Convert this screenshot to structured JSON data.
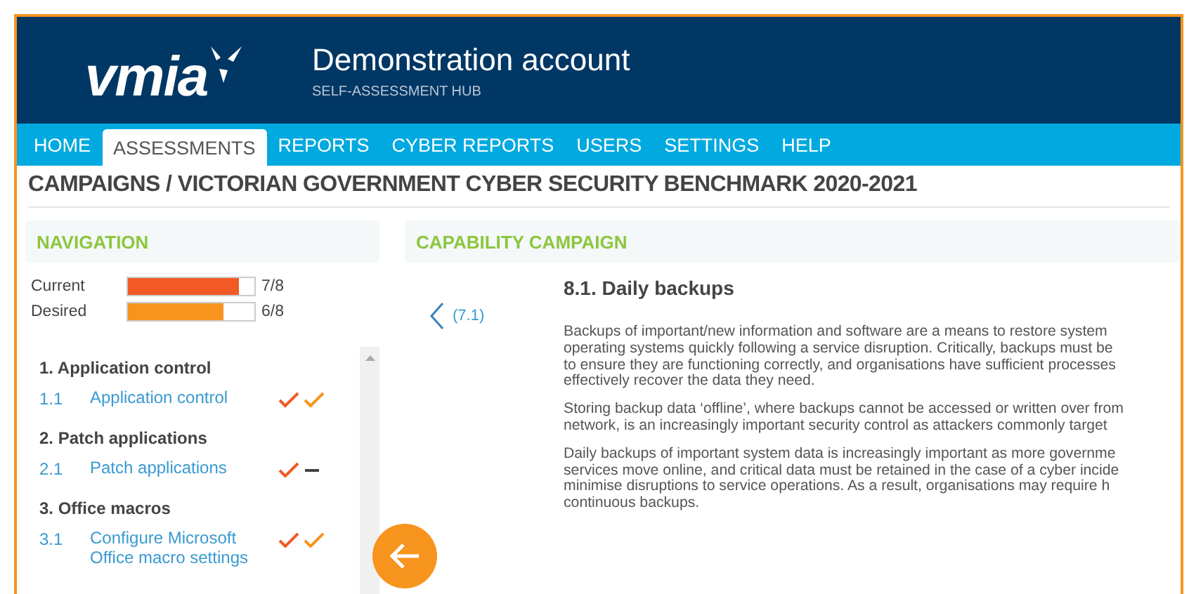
{
  "header": {
    "logo": "vmia",
    "title": "Demonstration account",
    "subtitle": "SELF-ASSESSMENT HUB"
  },
  "menu": [
    {
      "label": "HOME",
      "selected": false
    },
    {
      "label": "ASSESSMENTS",
      "selected": true
    },
    {
      "label": "REPORTS",
      "selected": false
    },
    {
      "label": "CYBER REPORTS",
      "selected": false
    },
    {
      "label": "USERS",
      "selected": false
    },
    {
      "label": "SETTINGS",
      "selected": false
    },
    {
      "label": "HELP",
      "selected": false
    }
  ],
  "breadcrumb": "CAMPAIGNS / VICTORIAN GOVERNMENT CYBER SECURITY BENCHMARK 2020-2021",
  "navigation": {
    "title": "NAVIGATION",
    "meters": [
      {
        "label": "Current",
        "level": 0.875,
        "reading": "7/8",
        "color": "#f15a24"
      },
      {
        "label": "Desired",
        "level": 0.75,
        "reading": "6/8",
        "color": "#f7941d"
      }
    ],
    "sections": [
      {
        "title": "1. Application control",
        "items": [
          {
            "number": "1.1",
            "label": "Application control",
            "current_met": true,
            "desired_met": true
          }
        ]
      },
      {
        "title": "2. Patch applications",
        "items": [
          {
            "number": "2.1",
            "label": "Patch applications",
            "current_met": true,
            "desired_met": false
          }
        ]
      },
      {
        "title": "3. Office macros",
        "items": [
          {
            "number": "3.1",
            "label": "Configure Microsoft Office macro settings",
            "current_met": true,
            "desired_met": true
          }
        ]
      }
    ]
  },
  "content": {
    "title": "CAPABILITY CAMPAIGN",
    "previous": "(7.1)",
    "heading": "8.1. Daily backups",
    "paragraphs": [
      [
        "Backups of important/new information and software are a means to restore system",
        "operating systems quickly following a service disruption. Critically, backups must be",
        "to ensure they are functioning correctly, and organisations have sufficient processes",
        "effectively recover the data they need."
      ],
      [
        "Storing backup data ‘offline’, where backups cannot be accessed or written over from",
        "network, is an increasingly important security control as attackers commonly target"
      ],
      [
        "Daily backups of important system data is increasingly important as more governme",
        "services move online, and critical data must be retained in the case of a cyber incide",
        "minimise disruptions to service operations. As a result, organisations may require h",
        "continuous backups."
      ]
    ]
  }
}
